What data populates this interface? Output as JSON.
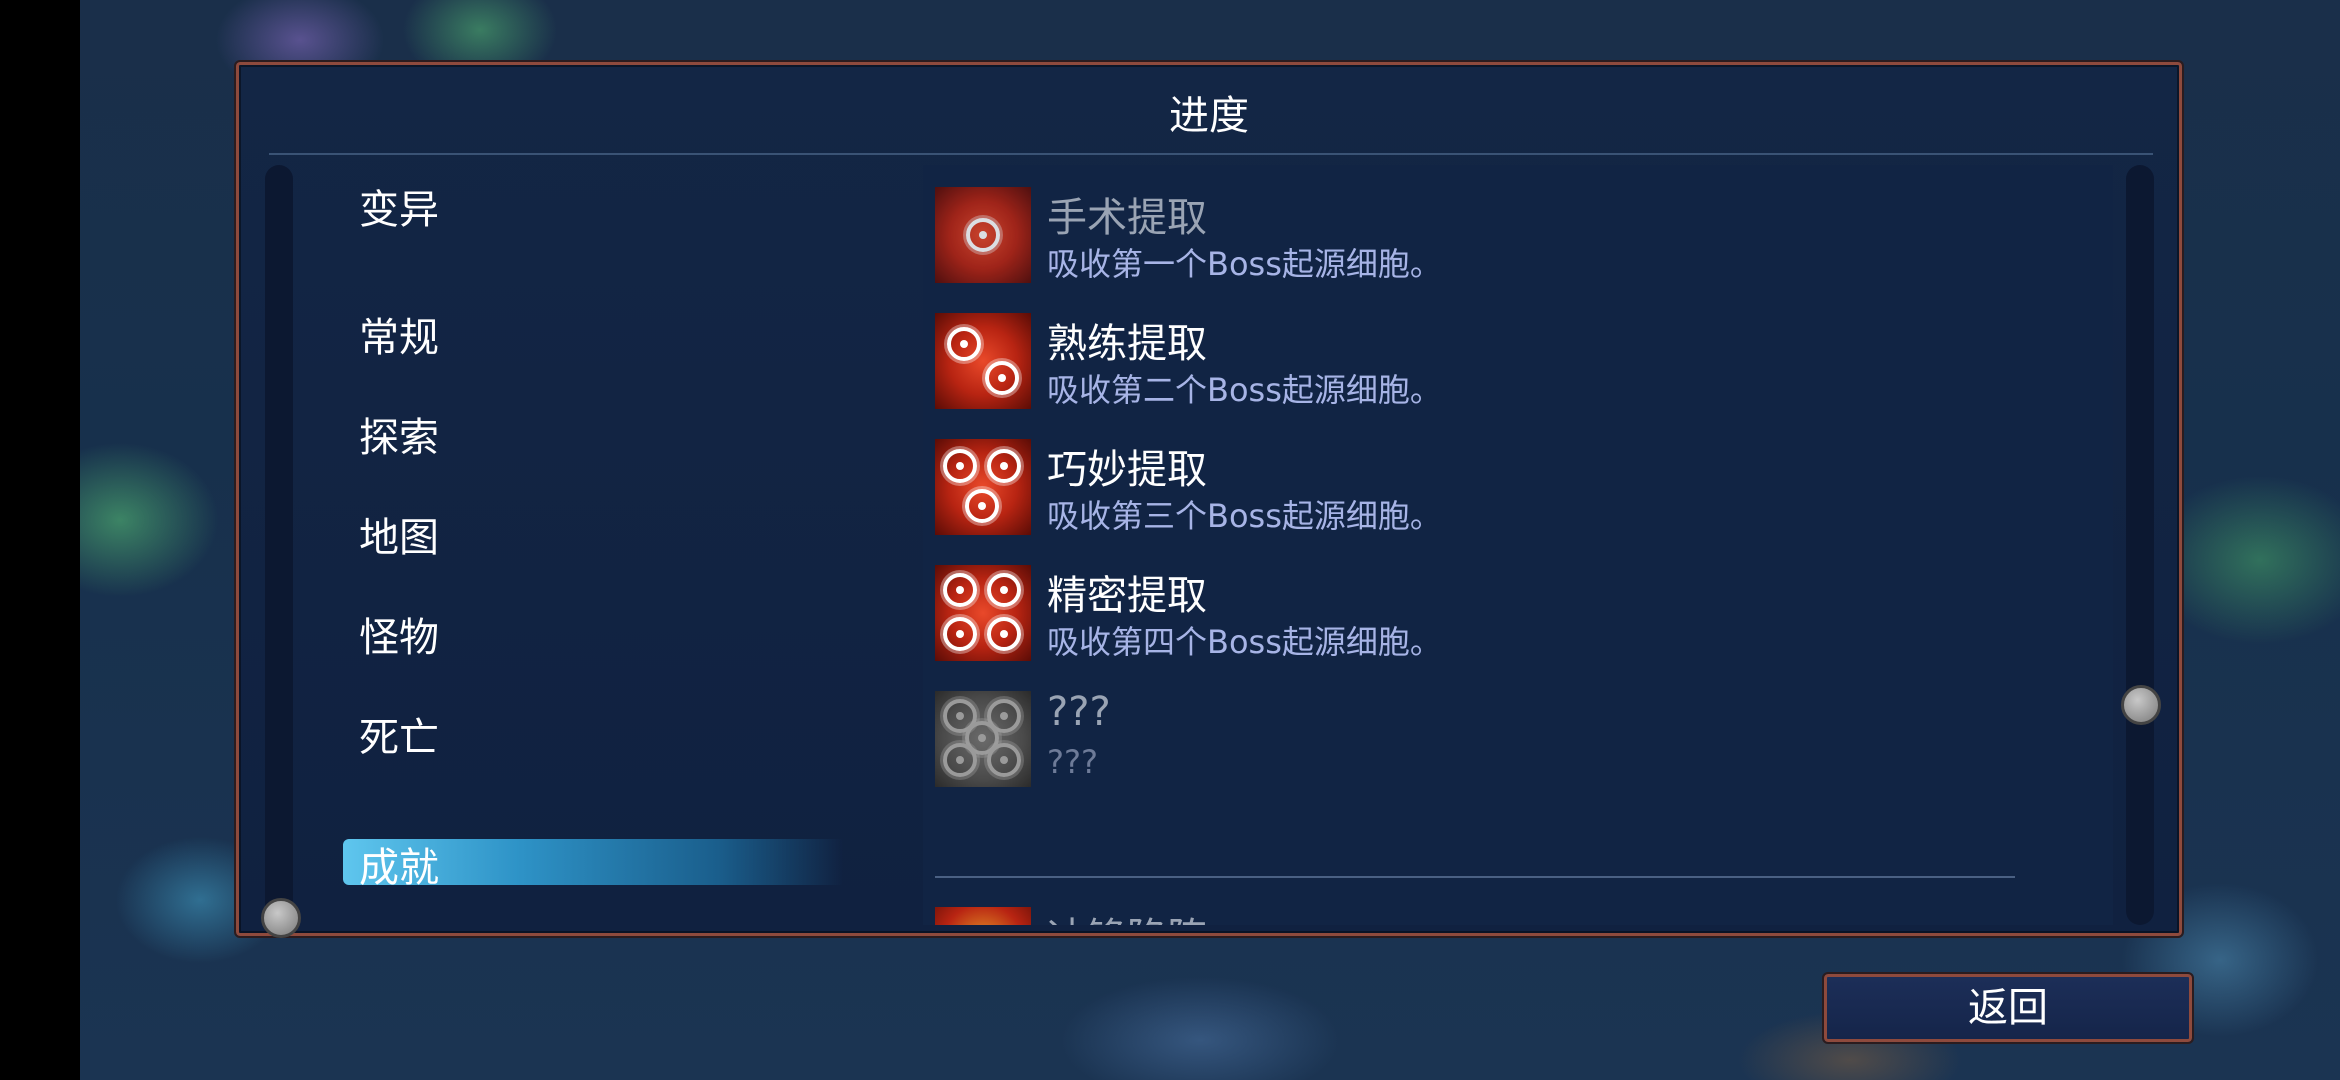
{
  "panel": {
    "title": "进度"
  },
  "categories": [
    {
      "label": "变异",
      "active": false
    },
    {
      "label": "常规",
      "active": false
    },
    {
      "label": "探索",
      "active": false
    },
    {
      "label": "地图",
      "active": false
    },
    {
      "label": "怪物",
      "active": false
    },
    {
      "label": "死亡",
      "active": false
    },
    {
      "label": "成就",
      "active": true
    }
  ],
  "achievements": [
    {
      "name": "手术提取",
      "desc": "吸收第一个Boss起源细胞。",
      "icon": "single-cell-icon",
      "state": "faded"
    },
    {
      "name": "熟练提取",
      "desc": "吸收第二个Boss起源细胞。",
      "icon": "double-cell-icon",
      "state": "unlocked"
    },
    {
      "name": "巧妙提取",
      "desc": "吸收第三个Boss起源细胞。",
      "icon": "triple-cell-icon",
      "state": "unlocked"
    },
    {
      "name": "精密提取",
      "desc": "吸收第四个Boss起源细胞。",
      "icon": "quad-cell-icon",
      "state": "unlocked"
    },
    {
      "name": "???",
      "desc": "???",
      "icon": "locked-cell-icon",
      "state": "locked"
    },
    {
      "name": "冲锋陷阵",
      "desc": "",
      "icon": "charge-cell-icon",
      "state": "partial"
    }
  ],
  "footer": {
    "back_label": "返回"
  },
  "colors": {
    "panel_border": "#8e4a3d",
    "panel_bg": "#132645",
    "active_tab": "#5fc6ee",
    "desc_text": "#a7b4e6",
    "icon_red": "#e9492a"
  }
}
